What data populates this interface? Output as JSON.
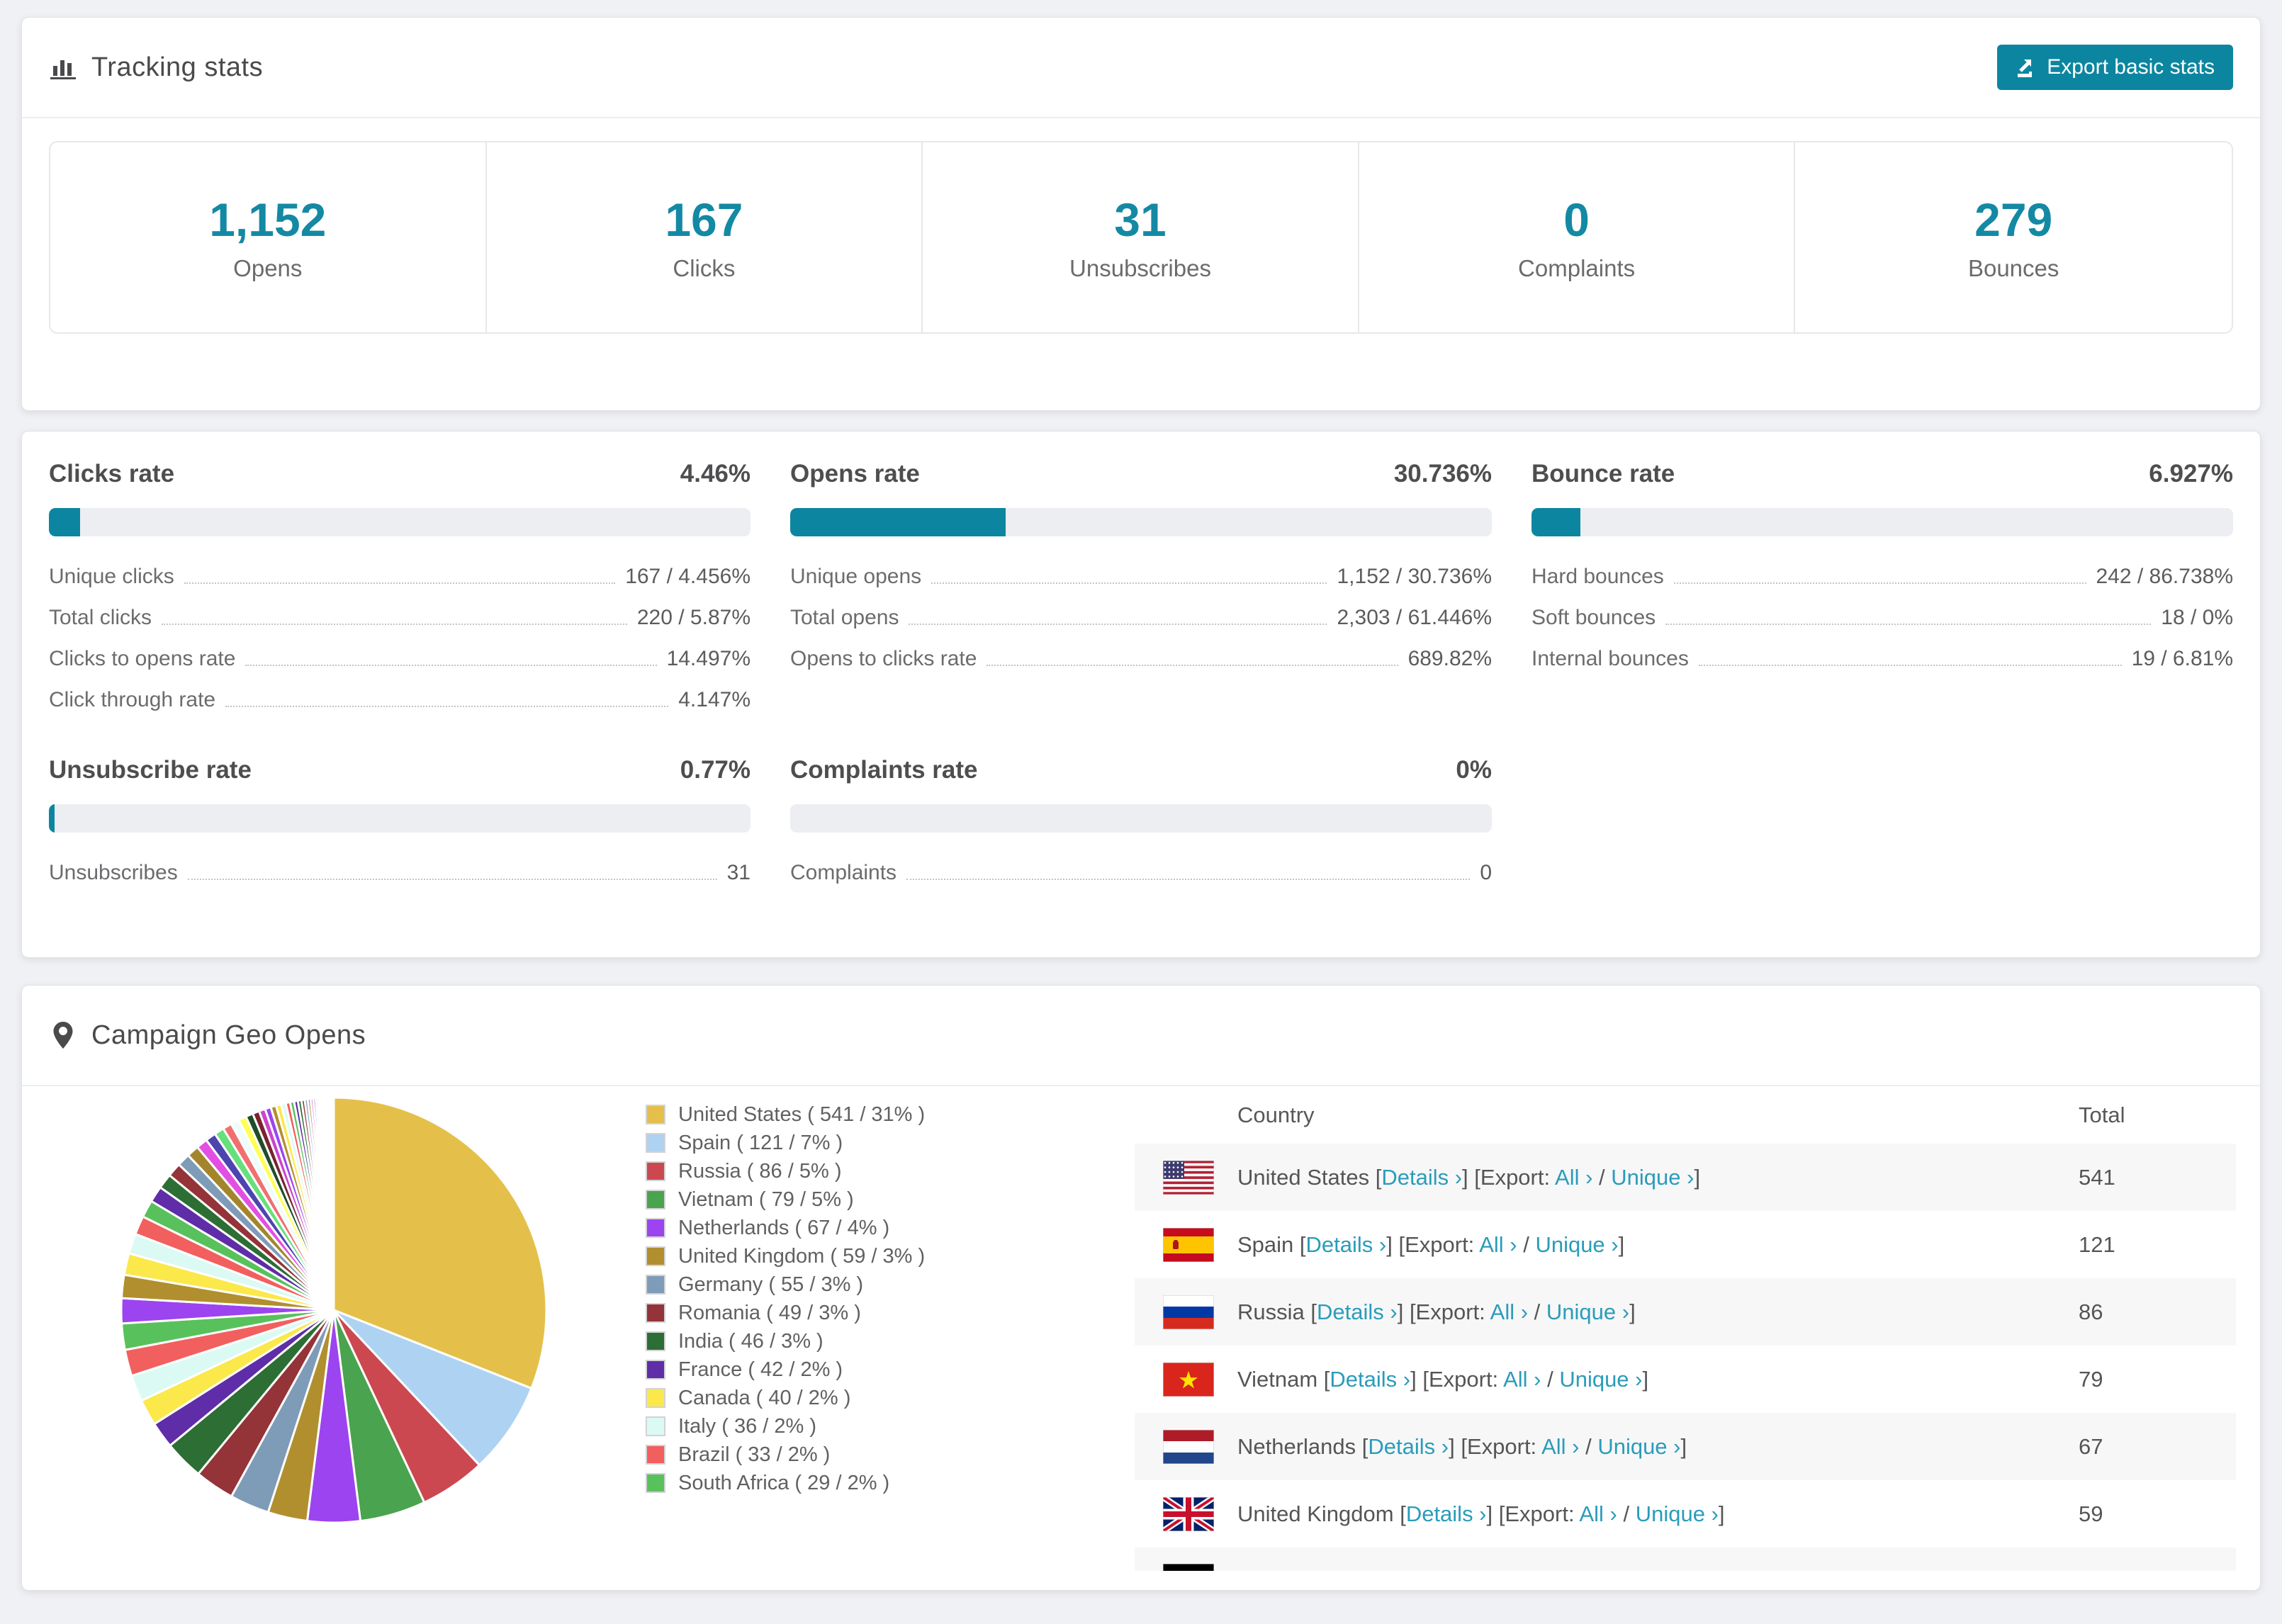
{
  "accent_color": "#0c86a0",
  "link_color": "#2a9cba",
  "stat_number_color": "#1489a4",
  "tracking": {
    "title": "Tracking stats",
    "export_button": "Export basic stats",
    "stats": [
      {
        "value": "1,152",
        "label": "Opens"
      },
      {
        "value": "167",
        "label": "Clicks"
      },
      {
        "value": "31",
        "label": "Unsubscribes"
      },
      {
        "value": "0",
        "label": "Complaints"
      },
      {
        "value": "279",
        "label": "Bounces"
      }
    ]
  },
  "rates": {
    "blocks": [
      {
        "title": "Clicks rate",
        "value": "4.46%",
        "percent": 4.46,
        "rows": [
          [
            "Unique clicks",
            "167 / 4.456%"
          ],
          [
            "Total clicks",
            "220 / 5.87%"
          ],
          [
            "Clicks to opens rate",
            "14.497%"
          ],
          [
            "Click through rate",
            "4.147%"
          ]
        ]
      },
      {
        "title": "Opens rate",
        "value": "30.736%",
        "percent": 30.736,
        "rows": [
          [
            "Unique opens",
            "1,152 / 30.736%"
          ],
          [
            "Total opens",
            "2,303 / 61.446%"
          ],
          [
            "Opens to clicks rate",
            "689.82%"
          ]
        ]
      },
      {
        "title": "Bounce rate",
        "value": "6.927%",
        "percent": 6.927,
        "rows": [
          [
            "Hard bounces",
            "242 / 86.738%"
          ],
          [
            "Soft bounces",
            "18 / 0%"
          ],
          [
            "Internal bounces",
            "19 / 6.81%"
          ]
        ]
      },
      {
        "title": "Unsubscribe rate",
        "value": "0.77%",
        "percent": 0.77,
        "rows": [
          [
            "Unsubscribes",
            "31"
          ]
        ]
      },
      {
        "title": "Complaints rate",
        "value": "0%",
        "percent": 0,
        "rows": [
          [
            "Complaints",
            "0"
          ]
        ]
      }
    ]
  },
  "geo": {
    "title": "Campaign Geo Opens",
    "table": {
      "headers": [
        "Country",
        "Total"
      ],
      "link_parts": {
        "open": "[",
        "details": "Details ›",
        "close": "] ",
        "export": "[Export: ",
        "all": "All ›",
        "slash": " / ",
        "unique": "Unique ›",
        "end": "]"
      },
      "rows": [
        {
          "country": "United States",
          "flag": "us",
          "total": "541"
        },
        {
          "country": "Spain",
          "flag": "es",
          "total": "121"
        },
        {
          "country": "Russia",
          "flag": "ru",
          "total": "86"
        },
        {
          "country": "Vietnam",
          "flag": "vn",
          "total": "79"
        },
        {
          "country": "Netherlands",
          "flag": "nl",
          "total": "67"
        },
        {
          "country": "United Kingdom",
          "flag": "gb",
          "total": "59"
        }
      ],
      "partial_row": {
        "flag": "de"
      }
    }
  },
  "chart_data": {
    "type": "pie",
    "title": "Campaign Geo Opens",
    "unit": "opens",
    "start_angle_deg": -90,
    "direction": "clockwise",
    "legend_position": "right-of-pie",
    "legend_format": "{label} ( {value} / {pct}% )",
    "slices": [
      {
        "label": "United States",
        "value": 541,
        "pct": 31,
        "color": "#e4c04b"
      },
      {
        "label": "Spain",
        "value": 121,
        "pct": 7,
        "color": "#aed3f2"
      },
      {
        "label": "Russia",
        "value": 86,
        "pct": 5,
        "color": "#cc4850"
      },
      {
        "label": "Vietnam",
        "value": 79,
        "pct": 5,
        "color": "#4aa34e"
      },
      {
        "label": "Netherlands",
        "value": 67,
        "pct": 4,
        "color": "#9b44f0"
      },
      {
        "label": "United Kingdom",
        "value": 59,
        "pct": 3,
        "color": "#b18f2e"
      },
      {
        "label": "Germany",
        "value": 55,
        "pct": 3,
        "color": "#7e9cb8"
      },
      {
        "label": "Romania",
        "value": 49,
        "pct": 3,
        "color": "#943338"
      },
      {
        "label": "India",
        "value": 46,
        "pct": 3,
        "color": "#2c6e34"
      },
      {
        "label": "France",
        "value": 42,
        "pct": 2,
        "color": "#5f2da8"
      },
      {
        "label": "Canada",
        "value": 40,
        "pct": 2,
        "color": "#fbe84b"
      },
      {
        "label": "Italy",
        "value": 36,
        "pct": 2,
        "color": "#dcfaf4"
      },
      {
        "label": "Brazil",
        "value": 33,
        "pct": 2,
        "color": "#f25f5f"
      },
      {
        "label": "South Africa",
        "value": 29,
        "pct": 2,
        "color": "#58c15c"
      }
    ],
    "others_tail": {
      "total_pct": 26,
      "slice_count": 44,
      "decay": 0.93,
      "colors": [
        "#9b44f0",
        "#b18f2e",
        "#fbe84b",
        "#dcfaf4",
        "#f25f5f",
        "#58c15c",
        "#5f2da8",
        "#2c6e34",
        "#943338",
        "#7e9cb8",
        "#a3862b",
        "#e24fe2",
        "#4d44b0",
        "#66e07a",
        "#f07070",
        "#eefcfb",
        "#ffff55",
        "#1f4d28",
        "#7a2430",
        "#cc44cc"
      ]
    }
  }
}
